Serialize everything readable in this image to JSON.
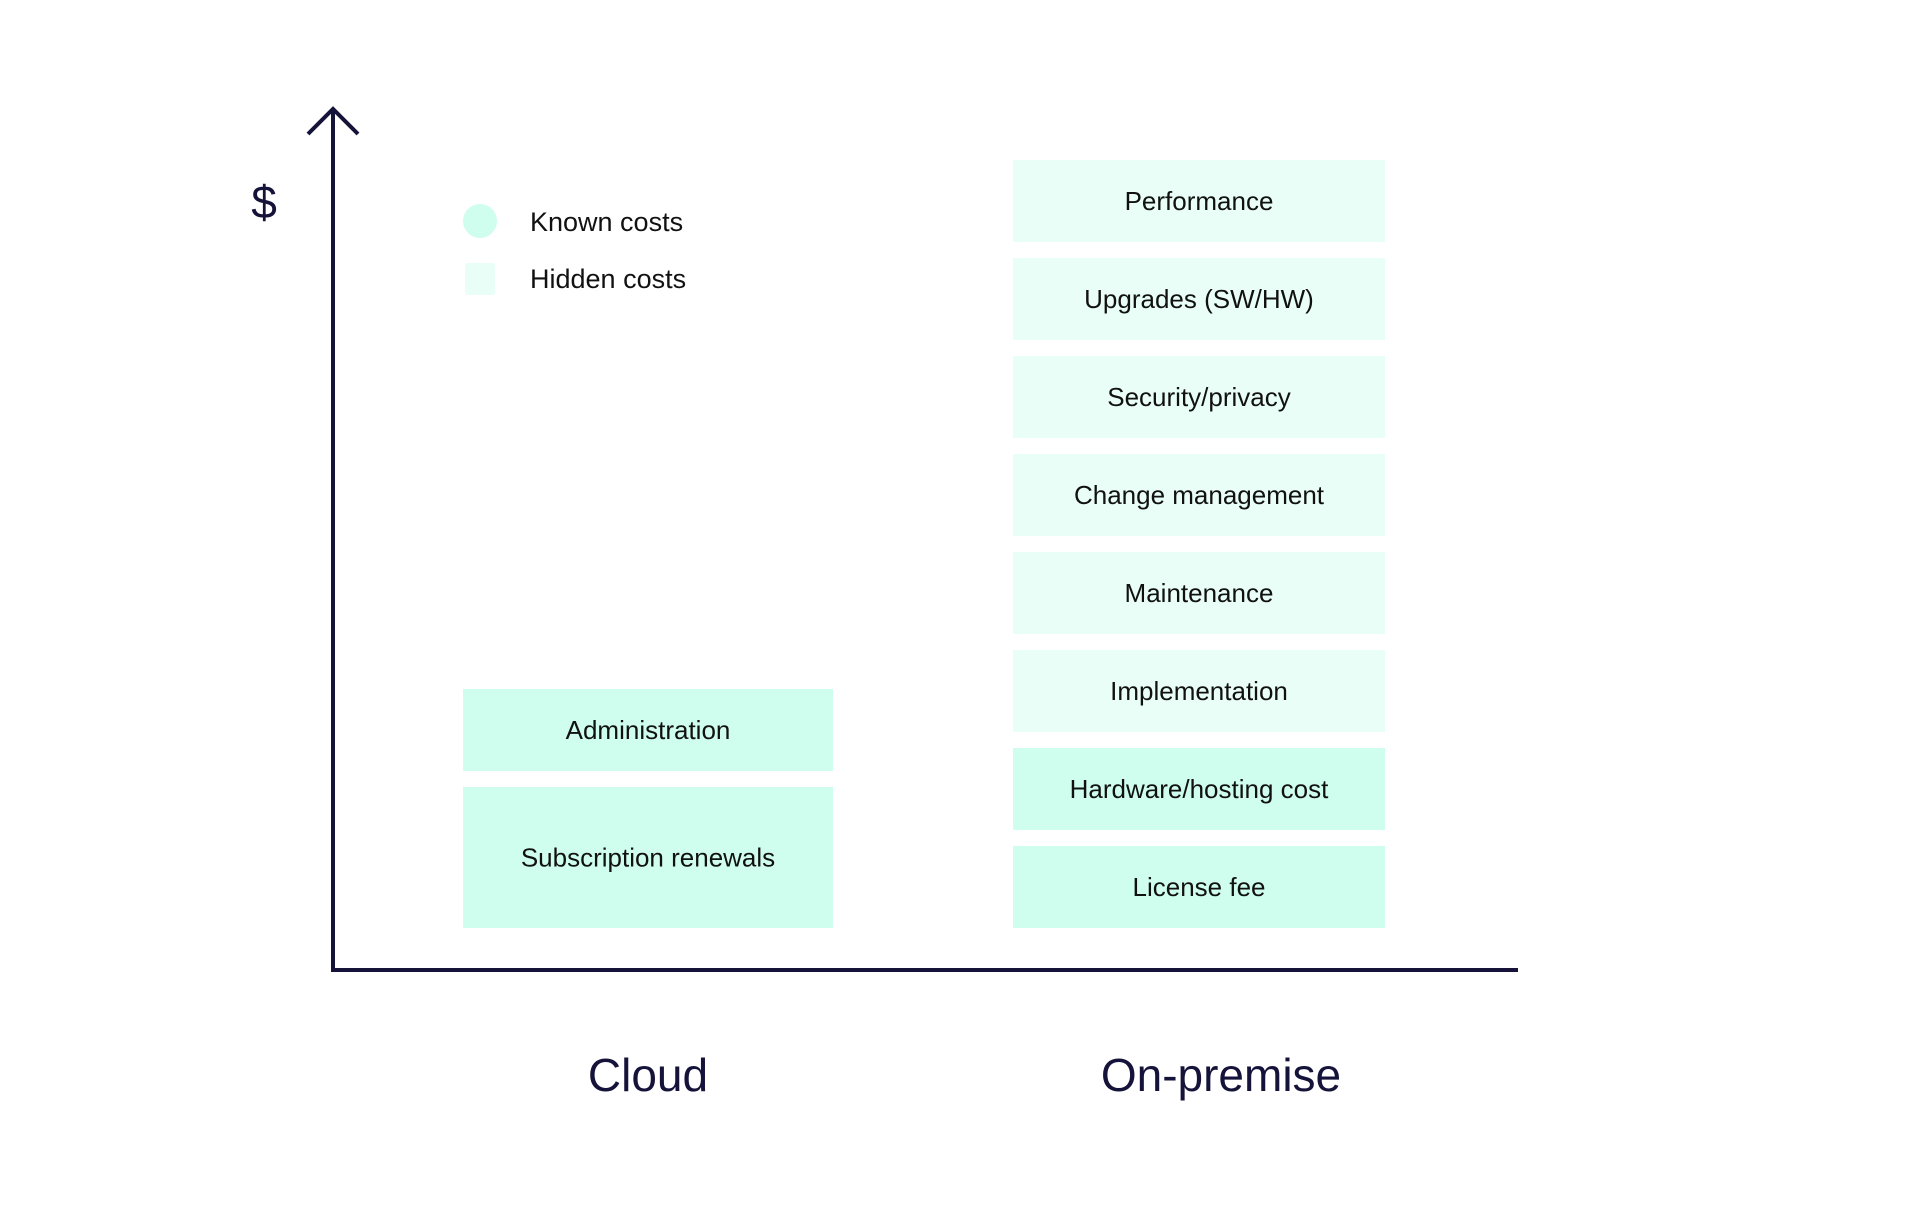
{
  "chart_data": {
    "type": "bar",
    "subtype": "stacked-labeled-blocks",
    "title": "",
    "ylabel": "$",
    "xlabel": "",
    "categories": [
      "Cloud",
      "On-premise"
    ],
    "legend": {
      "placement": "top-left",
      "entries": [
        {
          "key": "known",
          "label": "Known costs",
          "color": "#CFFDEE",
          "marker": "circle"
        },
        {
          "key": "hidden",
          "label": "Hidden costs",
          "color": "#E8FEF7",
          "marker": "square"
        }
      ]
    },
    "stacks": [
      {
        "category": "Cloud",
        "blocks": [
          {
            "label": "Subscription renewals",
            "type": "known",
            "units": 1.5
          },
          {
            "label": "Administration",
            "type": "known",
            "units": 1
          }
        ]
      },
      {
        "category": "On-premise",
        "blocks": [
          {
            "label": "License fee",
            "type": "known",
            "units": 1
          },
          {
            "label": "Hardware/hosting cost",
            "type": "known",
            "units": 1
          },
          {
            "label": "Implementation",
            "type": "hidden",
            "units": 1
          },
          {
            "label": "Maintenance",
            "type": "hidden",
            "units": 1
          },
          {
            "label": "Change management",
            "type": "hidden",
            "units": 1
          },
          {
            "label": "Security/privacy",
            "type": "hidden",
            "units": 1
          },
          {
            "label": "Upgrades (SW/HW)",
            "type": "hidden",
            "units": 1
          },
          {
            "label": "Performance",
            "type": "hidden",
            "units": 1
          }
        ]
      }
    ],
    "axis_color": "#15133A",
    "grid": false
  }
}
